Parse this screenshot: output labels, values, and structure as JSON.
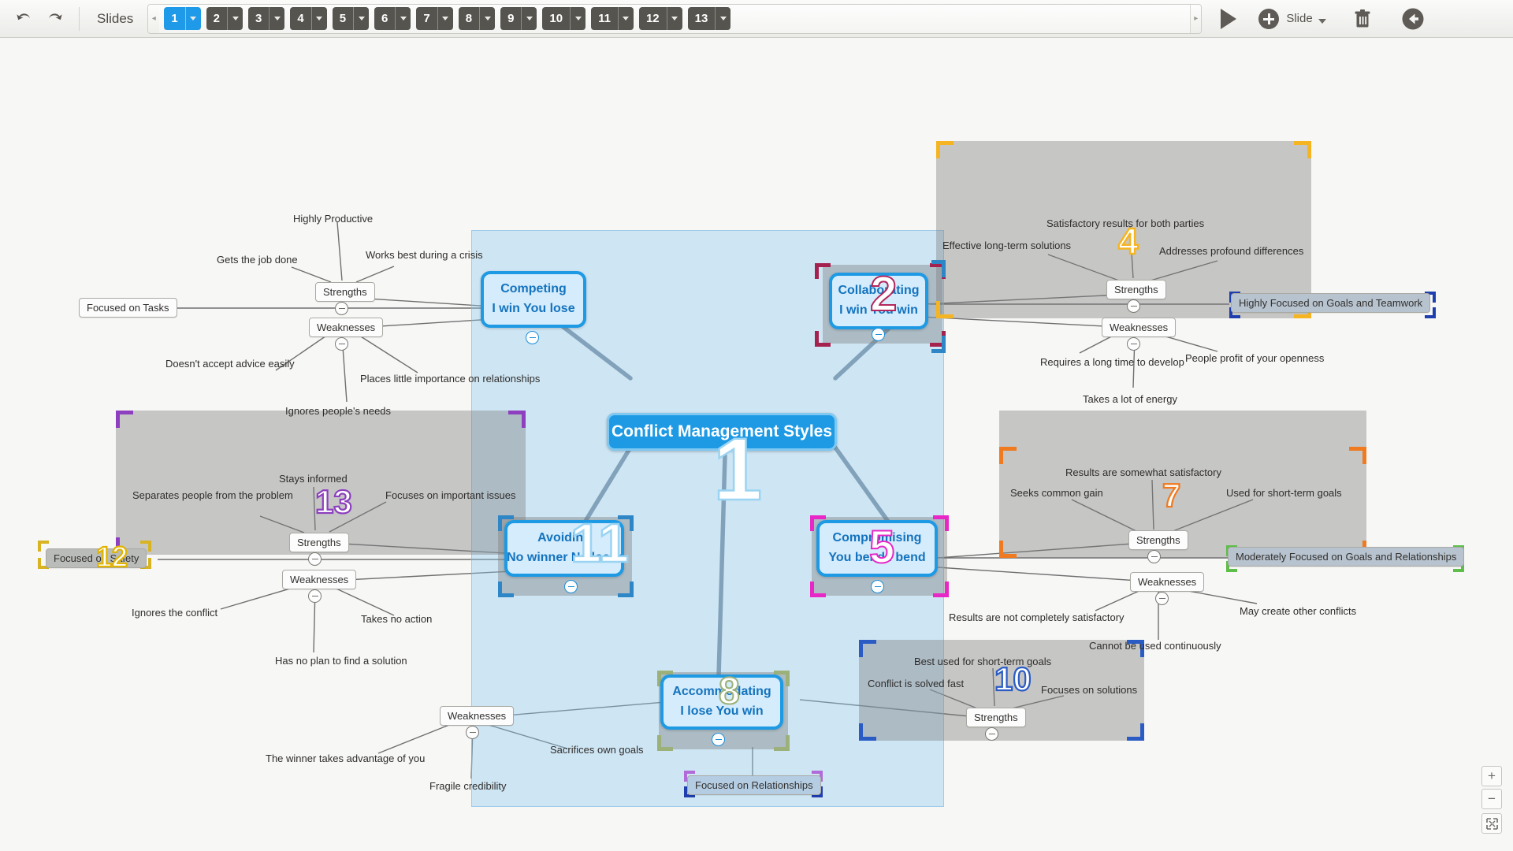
{
  "toolbar": {
    "undo_icon": "undo-arrow-icon",
    "redo_icon": "redo-arrow-icon",
    "slides_label": "Slides",
    "slides": [
      {
        "num": "1",
        "active": true
      },
      {
        "num": "2",
        "active": false
      },
      {
        "num": "3",
        "active": false
      },
      {
        "num": "4",
        "active": false
      },
      {
        "num": "5",
        "active": false
      },
      {
        "num": "6",
        "active": false
      },
      {
        "num": "7",
        "active": false
      },
      {
        "num": "8",
        "active": false
      },
      {
        "num": "9",
        "active": false
      },
      {
        "num": "10",
        "active": false
      },
      {
        "num": "11",
        "active": false
      },
      {
        "num": "12",
        "active": false
      },
      {
        "num": "13",
        "active": false
      }
    ],
    "play_label": "play-presentation",
    "add_slide_label": "Slide",
    "delete_label": "delete-slide",
    "exit_label": "back"
  },
  "zoom_controls": {
    "zoom_in": "+",
    "zoom_out": "−",
    "fit": "fit-to-screen"
  },
  "map": {
    "center": {
      "title": "Conflict Management Styles"
    },
    "styles": [
      {
        "id": "competing",
        "title": "Competing",
        "subtitle": "I win You lose"
      },
      {
        "id": "collaborating",
        "title": "Collaborating",
        "subtitle": "I win You win"
      },
      {
        "id": "avoiding",
        "title": "Avoiding",
        "subtitle": "No winner No loser"
      },
      {
        "id": "compromising",
        "title": "Compromising",
        "subtitle": "You bend I bend"
      },
      {
        "id": "accommodating",
        "title": "Accommodating",
        "subtitle": "I lose You win"
      }
    ],
    "labels": {
      "strengths": "Strengths",
      "weaknesses": "Weaknesses"
    },
    "branches": {
      "competing": {
        "focus": "Focused on Tasks",
        "strengths": [
          "Highly Productive",
          "Gets the job done",
          "Works best during a crisis"
        ],
        "weaknesses": [
          "Doesn't accept advice easily",
          "Places little importance on relationships",
          "Ignores people's needs"
        ]
      },
      "collaborating": {
        "focus": "Highly Focused on Goals and Teamwork",
        "strengths": [
          "Satisfactory results for both parties",
          "Effective long-term solutions",
          "Addresses profound differences"
        ],
        "weaknesses": [
          "Requires a long time to develop",
          "People profit of your openness",
          "Takes a lot of energy"
        ]
      },
      "avoiding": {
        "focus": "Focused on Safety",
        "strengths": [
          "Stays informed",
          "Separates people from the problem",
          "Focuses on important issues"
        ],
        "weaknesses": [
          "Ignores the conflict",
          "Takes no action",
          "Has no plan to find a solution"
        ]
      },
      "compromising": {
        "focus": "Moderately Focused on Goals and Relationships",
        "strengths": [
          "Results are somewhat satisfactory",
          "Seeks common gain",
          "Used for short-term goals"
        ],
        "weaknesses": [
          "Results are not completely satisfactory",
          "Cannot be used continuously",
          "May create other conflicts"
        ]
      },
      "accommodating": {
        "focus": "Focused on Relationships",
        "strengths": [
          "Best used for short-term goals",
          "Conflict is solved fast",
          "Focuses on solutions"
        ],
        "weaknesses": [
          "The winner takes advantage of you",
          "Sacrifices own goals",
          "Fragile credibility"
        ]
      }
    },
    "slide_markers": [
      {
        "num": "1",
        "color": "#ffffff",
        "outline": "#9bd4f2"
      },
      {
        "num": "2",
        "color": "#ffffff",
        "outline": "#b3275c"
      },
      {
        "num": "4",
        "color": "#ffffff",
        "outline": "#f5b522"
      },
      {
        "num": "5",
        "color": "#ffffff",
        "outline": "#e828c6"
      },
      {
        "num": "7",
        "color": "#ffffff",
        "outline": "#ef7a1f"
      },
      {
        "num": "8",
        "color": "#ffffff",
        "outline": "#9cb17a"
      },
      {
        "num": "10",
        "color": "#ffffff",
        "outline": "#2b5cc4"
      },
      {
        "num": "11",
        "color": "#ffffff",
        "outline": "#9bd4f2"
      },
      {
        "num": "12",
        "color": "#ffffff",
        "outline": "#e0b400"
      },
      {
        "num": "13",
        "color": "#ffffff",
        "outline": "#8d3fbf"
      }
    ],
    "selection_colors": {
      "slide_1_region": "#7ec8f2",
      "collaborating_frame": "#a5224f",
      "collab_focus_frame": "#1f3fae",
      "collab_group_frame": "#f5b522",
      "avoiding_frame": "#2f86c6",
      "avoiding_group_frame": "#8d3fbf",
      "avoiding_focus_frame": "#d8b423",
      "compromising_frame": "#e828c6",
      "compromising_group_frame": "#ef7a1f",
      "compromising_focus_frame": "#5fbd4a",
      "accommodating_frame": "#9cb17a",
      "accommodating_focus_frame": "#1f3fae",
      "accommodating_group_frame": "#2b5cc4",
      "accommodating_focus_sel": "#b06bd8"
    }
  }
}
